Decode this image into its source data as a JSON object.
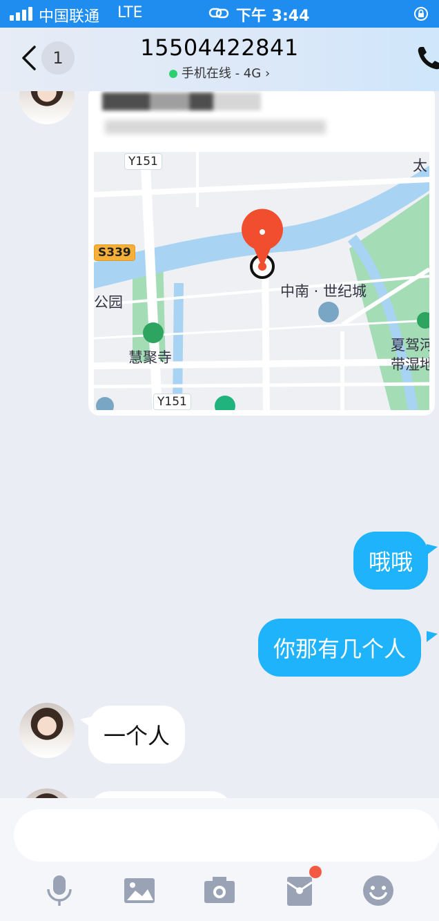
{
  "status_bar": {
    "carrier": "中国联通",
    "network": "LTE",
    "time": "下午 3:44"
  },
  "header": {
    "back_count": "1",
    "title": "15504422841",
    "subtitle": "手机在线 - 4G"
  },
  "location_card": {
    "map_labels": {
      "road_y151_top": "Y151",
      "road_y151_bottom": "Y151",
      "road_s339": "S339",
      "park": "公园",
      "temple": "慧聚寺",
      "poi_main": "中南 · 世纪城",
      "poi_right_1": "夏驾河",
      "poi_right_2": "带湿地",
      "poi_top_right": "太"
    }
  },
  "messages": [
    {
      "direction": "out",
      "text": "哦哦"
    },
    {
      "direction": "out",
      "text": "你那有几个人"
    },
    {
      "direction": "in",
      "text": "一个人"
    }
  ],
  "input_bar": {
    "placeholder": "",
    "tools": [
      "mic-icon",
      "image-icon",
      "camera-icon",
      "red-packet-icon",
      "emoji-icon"
    ]
  },
  "colors": {
    "status_bar": "#1f8df0",
    "out_bubble": "#1eb3fb",
    "in_bubble": "#ffffff",
    "chat_bg": "#eaedf4",
    "map_pin": "#f04e2f",
    "badge": "#f45a43"
  }
}
